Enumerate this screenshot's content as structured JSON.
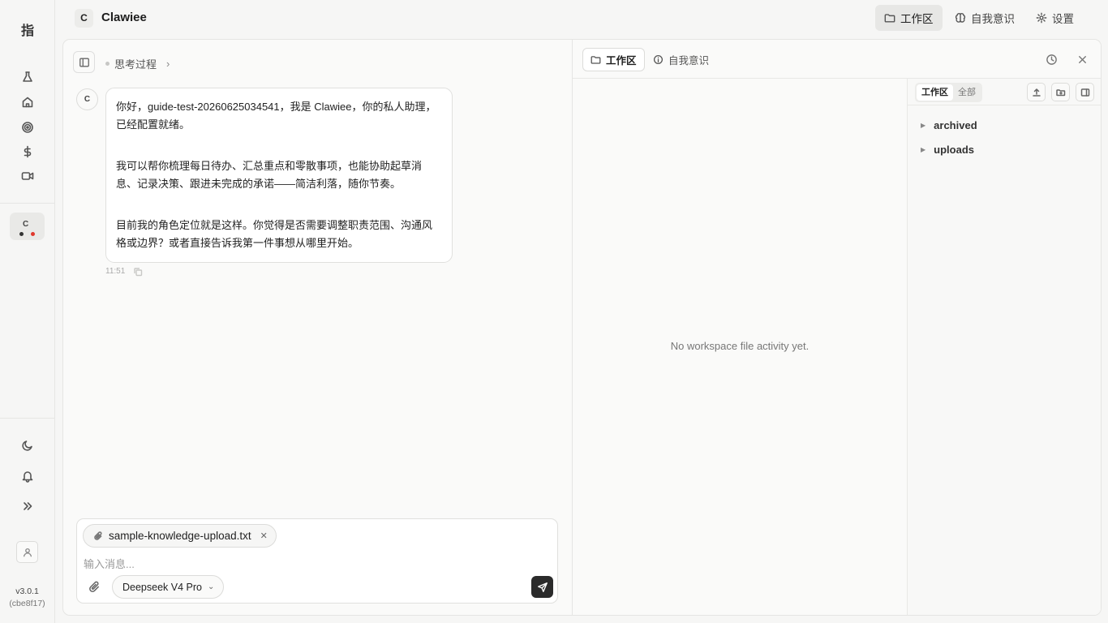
{
  "rail": {
    "logo": "指",
    "agent_initial": "C",
    "version": "v3.0.1",
    "build": "(cbe8f17)"
  },
  "topbar": {
    "brand_initial": "C",
    "brand_name": "Clawiee",
    "nav": {
      "workspace": "工作区",
      "self_awareness": "自我意识",
      "settings": "设置"
    }
  },
  "chat": {
    "thinking_label": "思考过程",
    "avatar_initial": "C",
    "message": {
      "paragraphs": [
        "你好，guide-test-20260625034541，我是 Clawiee，你的私人助理，已经配置就绪。",
        "我可以帮你梳理每日待办、汇总重点和零散事项，也能协助起草消息、记录决策、跟进未完成的承诺——简洁利落，随你节奏。",
        "目前我的角色定位就是这样。你觉得是否需要调整职责范围、沟通风格或边界？或者直接告诉我第一件事想从哪里开始。"
      ],
      "time": "11:51"
    },
    "composer": {
      "attachment": "sample-knowledge-upload.txt",
      "placeholder": "输入消息...",
      "value": "",
      "model": "Deepseek V4 Pro"
    }
  },
  "workspace": {
    "tabs": {
      "workspace": "工作区",
      "self_awareness": "自我意识"
    },
    "empty_text": "No workspace file activity yet.",
    "scope": {
      "workspace": "工作区",
      "all": "全部"
    },
    "folders": [
      "archived",
      "uploads"
    ]
  },
  "colors": {
    "send_button": "#2b2b2b",
    "notification_dot": "#e0382d"
  }
}
